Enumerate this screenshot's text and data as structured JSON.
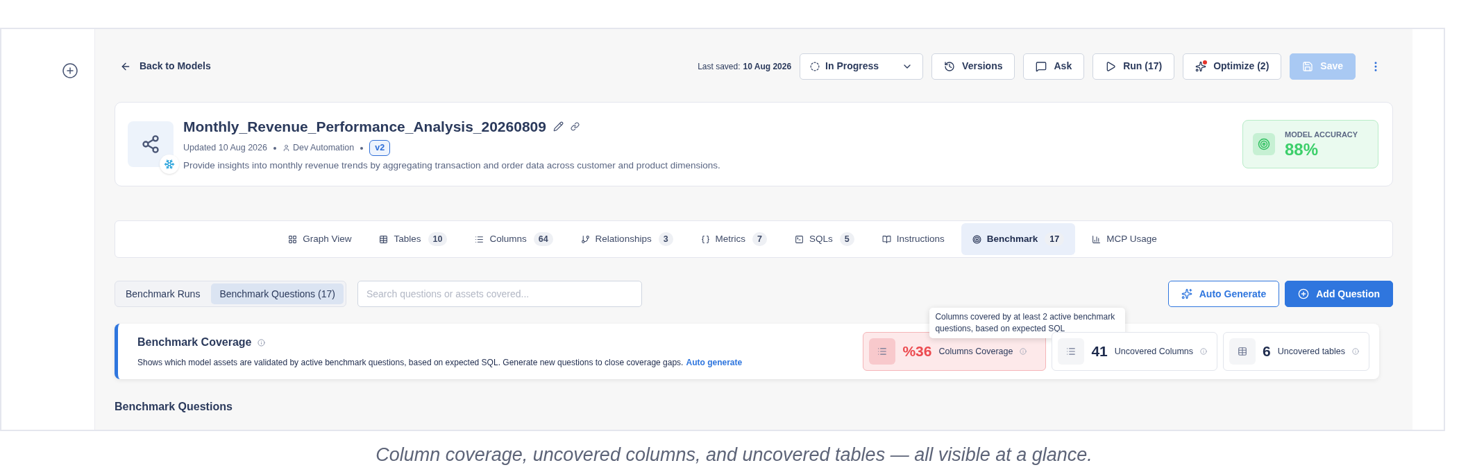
{
  "top_bar": {
    "back_link": "Back to Models",
    "last_saved_label": "Last saved:",
    "last_saved_value": "10 Aug 2026",
    "status": "In Progress",
    "buttons": [
      {
        "label": "Versions",
        "kind": "versions",
        "disabled": false,
        "alert": false
      },
      {
        "label": "Ask",
        "kind": "ask",
        "disabled": false,
        "alert": false
      },
      {
        "label": "Run (17)",
        "kind": "run",
        "disabled": false,
        "alert": false
      },
      {
        "label": "Optimize (2)",
        "kind": "optimize",
        "disabled": false,
        "alert": true
      },
      {
        "label": "Save",
        "kind": "save",
        "disabled": true,
        "alert": false
      }
    ]
  },
  "model": {
    "name": "Monthly_Revenue_Performance_Analysis_20260809",
    "updated": "Updated 10 Aug 2026",
    "author": "Dev Automation",
    "version": "v2",
    "description": "Provide insights into monthly revenue trends by aggregating transaction and order data across customer and product dimensions.",
    "accuracy_label": "MODEL ACCURACY",
    "accuracy_value": "88%"
  },
  "tabs": [
    {
      "label": "Graph View",
      "selected": false
    },
    {
      "label": "Tables",
      "count": "10",
      "selected": false
    },
    {
      "label": "Columns",
      "count": "64",
      "selected": false
    },
    {
      "label": "Relationships",
      "count": "3",
      "selected": false
    },
    {
      "label": "Metrics",
      "count": "7",
      "selected": false
    },
    {
      "label": "SQLs",
      "count": "5",
      "selected": false
    },
    {
      "label": "Instructions",
      "selected": false
    },
    {
      "label": "Benchmark",
      "count": "17",
      "selected": true
    },
    {
      "label": "MCP Usage",
      "selected": false
    }
  ],
  "subtabs": [
    {
      "label": "Benchmark Runs",
      "selected": false
    },
    {
      "label": "Benchmark Questions (17)",
      "selected": true
    }
  ],
  "search": {
    "placeholder": "Search questions or assets covered..."
  },
  "actions": [
    {
      "label": "Auto Generate",
      "kind": "outline"
    },
    {
      "label": "Add Question",
      "kind": "primary"
    }
  ],
  "coverage": {
    "title": "Benchmark Coverage",
    "description": "Shows which model assets are validated by active benchmark questions, based on expected SQL. Generate new questions to close coverage gaps.",
    "link": "Auto generate",
    "stats": [
      {
        "value": "%36",
        "label": "Columns Coverage",
        "kind": "columns",
        "alert": true,
        "tooltip": "Columns covered by at least 2 active benchmark questions, based on expected SQL"
      },
      {
        "value": "41",
        "label": "Uncovered Columns",
        "kind": "columns",
        "alert": false
      },
      {
        "value": "6",
        "label": "Uncovered tables",
        "kind": "table",
        "alert": false
      }
    ]
  },
  "section_title": "Benchmark Questions",
  "caption": "Column coverage, uncovered columns, and uncovered tables — all visible at a glance."
}
